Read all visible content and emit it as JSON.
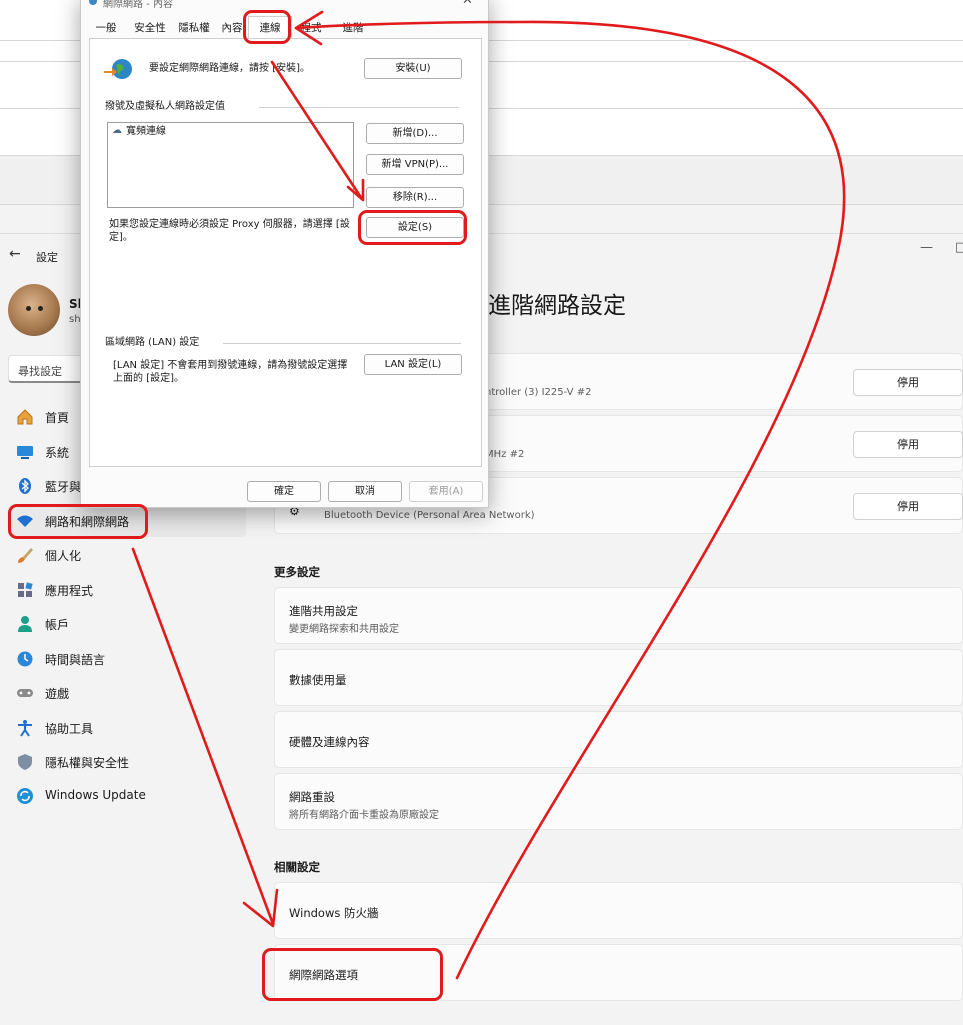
{
  "dialog": {
    "title": "網際網路 - 內容",
    "tabs": [
      "一般",
      "安全性",
      "隱私權",
      "內容",
      "連線",
      "程式",
      "進階"
    ],
    "setup_text": "要設定網際網路連線，請按 [安裝]。",
    "setup_button": "安裝(U)",
    "dialup_group": "撥號及虛擬私人網路設定值",
    "connections": [
      "寬頻連線"
    ],
    "add_button": "新增(D)...",
    "add_vpn_button": "新增 VPN(P)...",
    "remove_button": "移除(R)...",
    "settings_button": "設定(S)",
    "proxy_text_1": "如果您設定連線時必須設定 Proxy 伺服器，請選擇 [設",
    "proxy_text_2": "定]。",
    "lan_group": "區域網路 (LAN) 設定",
    "lan_text_1": "[LAN 設定] 不會套用到撥號連線，請為撥號設定選擇",
    "lan_text_2": "上面的 [設定]。",
    "lan_button": "LAN 設定(L)",
    "ok_button": "確定",
    "cancel_button": "取消",
    "apply_button": "套用(A)"
  },
  "settings": {
    "window_title": "設定",
    "user_name": "Sh",
    "user_sub": "sh",
    "search_placeholder": "尋找設定",
    "nav": [
      {
        "label": "首頁",
        "icon": "home-icon"
      },
      {
        "label": "系統",
        "icon": "system-icon"
      },
      {
        "label": "藍牙與",
        "icon": "bluetooth-icon"
      },
      {
        "label": "網路和網際網路",
        "icon": "wifi-icon"
      },
      {
        "label": "個人化",
        "icon": "brush-icon"
      },
      {
        "label": "應用程式",
        "icon": "apps-icon"
      },
      {
        "label": "帳戶",
        "icon": "account-icon"
      },
      {
        "label": "時間與語言",
        "icon": "clock-icon"
      },
      {
        "label": "遊戲",
        "icon": "gamepad-icon"
      },
      {
        "label": "協助工具",
        "icon": "accessibility-icon"
      },
      {
        "label": "隱私權與安全性",
        "icon": "shield-icon"
      },
      {
        "label": "Windows Update",
        "icon": "update-icon"
      }
    ],
    "page_title": "進階網路設定",
    "adapters": [
      {
        "desc": "ntroller (3) I225-V #2",
        "button": "停用"
      },
      {
        "desc": "MHz #2",
        "button": "停用"
      },
      {
        "desc": "Bluetooth Device (Personal Area Network)",
        "button": "停用"
      }
    ],
    "more_settings_heading": "更多設定",
    "more_settings": [
      {
        "title": "進階共用設定",
        "sub": "變更網路探索和共用設定"
      },
      {
        "title": "數據使用量",
        "sub": ""
      },
      {
        "title": "硬體及連線內容",
        "sub": ""
      },
      {
        "title": "網路重設",
        "sub": "將所有網路介面卡重設為原廠設定"
      }
    ],
    "related_heading": "相關設定",
    "related": [
      {
        "title": "Windows 防火牆"
      },
      {
        "title": "網際網路選項"
      }
    ]
  },
  "colors": {
    "annotation": "#e11b1b",
    "accent": "#0067c0"
  }
}
